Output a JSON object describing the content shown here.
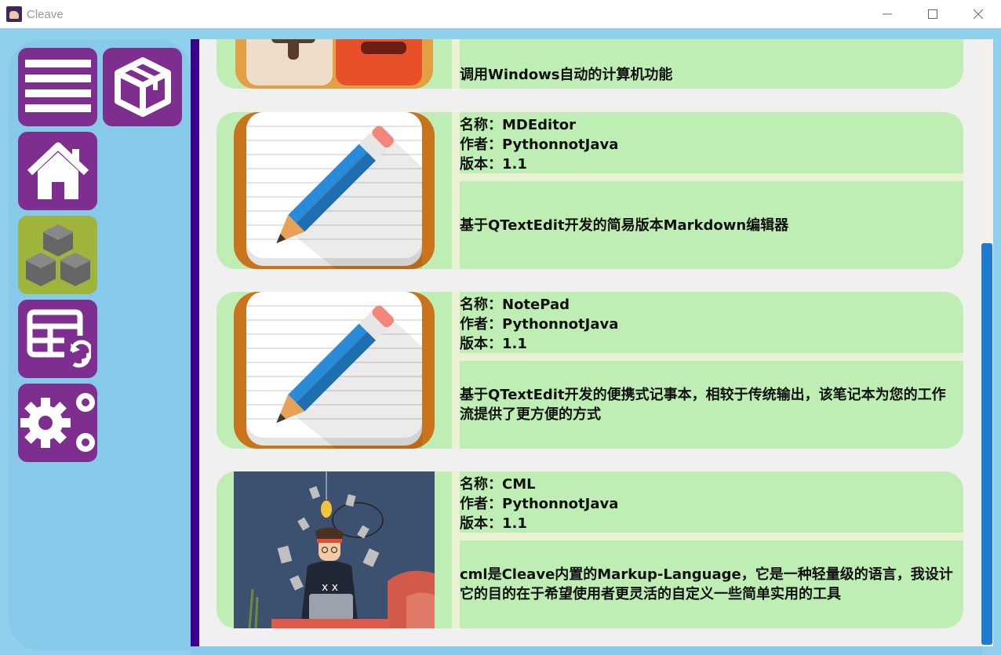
{
  "window": {
    "title": "Cleave"
  },
  "sidebar": {
    "items": [
      {
        "name": "menu-button",
        "icon": "menu-icon"
      },
      {
        "name": "package-button",
        "icon": "package-box-icon"
      },
      {
        "name": "home-button",
        "icon": "home-icon"
      },
      {
        "name": "plugins-button",
        "icon": "cubes-icon",
        "active": true
      },
      {
        "name": "table-refresh-button",
        "icon": "table-refresh-icon"
      },
      {
        "name": "settings-button",
        "icon": "gears-icon"
      }
    ]
  },
  "cards": [
    {
      "desc": "调用Windows自动的计算机功能",
      "icon": "calculator-icon"
    },
    {
      "name_label": "名称：MDEditor",
      "author_label": "作者：PythonnotJava",
      "version_label": "版本：1.1",
      "desc": "基于QTextEdit开发的简易版本Markdown编辑器",
      "icon": "notepad-pencil-icon"
    },
    {
      "name_label": "名称：NotePad",
      "author_label": "作者：PythonnotJava",
      "version_label": "版本：1.1",
      "desc": "基于QTextEdit开发的便携式记事本，相较于传统输出，该笔记本为您的工作流提供了更方便的方式",
      "icon": "notepad-pencil-icon"
    },
    {
      "name_label": "名称：CML",
      "author_label": "作者：PythonnotJava",
      "version_label": "版本：1.1",
      "desc": "cml是Cleave内置的Markup-Language，它是一种轻量级的语言，我设计它的目的在于希望使用者更灵活的自定义一些简单实用的工具",
      "icon": "developer-illustration-icon"
    }
  ],
  "colors": {
    "nav": "#7d2e8e",
    "nav_active": "#9fb43a",
    "card": "#bfeeb4",
    "accent_border": "#3b008e",
    "scroll_thumb": "#1f7bd1"
  }
}
